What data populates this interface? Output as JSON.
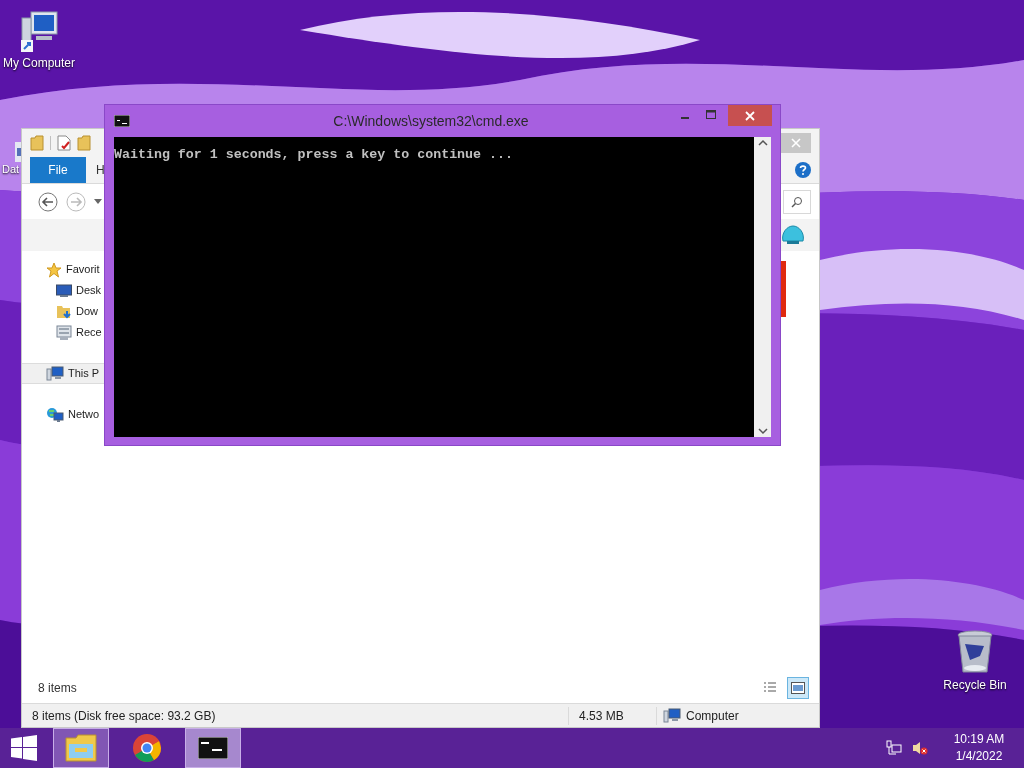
{
  "desktop": {
    "icons": [
      {
        "kind": "computer",
        "label": "My Computer"
      },
      {
        "kind": "file",
        "label": "Dat"
      },
      {
        "kind": "bin",
        "label": "Recycle Bin"
      }
    ]
  },
  "explorer": {
    "ribbon_tabs": [
      {
        "label": "File",
        "selected": true
      },
      {
        "label": "H",
        "selected": false
      }
    ],
    "navigation": [
      {
        "kind": "star",
        "label": "Favorit",
        "selected": false,
        "children": [
          {
            "kind": "desktop",
            "label": "Desk",
            "selected": false
          },
          {
            "kind": "downloads",
            "label": "Dow",
            "selected": false
          },
          {
            "kind": "recent",
            "label": "Rece",
            "selected": false
          }
        ]
      },
      {
        "kind": "pc",
        "label": "This P",
        "selected": true
      },
      {
        "kind": "network",
        "label": "Netwo",
        "selected": false
      }
    ],
    "item_count": "8 items",
    "view_buttons": [
      {
        "kind": "details",
        "selected": false
      },
      {
        "kind": "tiles",
        "selected": true
      }
    ],
    "status_bar": [
      "8 items (Disk free space: 93.2 GB)",
      "4.53 MB",
      "Computer"
    ]
  },
  "console": {
    "title": "C:\\Windows\\system32\\cmd.exe",
    "lines": [
      "Waiting for 1 seconds, press a key to continue ..."
    ]
  },
  "taskbar": {
    "apps": [
      {
        "kind": "explorer",
        "running": true,
        "selected": false
      },
      {
        "kind": "chrome",
        "running": false,
        "selected": false
      },
      {
        "kind": "console",
        "running": true,
        "selected": true
      }
    ],
    "clock": {
      "time": "10:19 AM",
      "date": "1/4/2022"
    }
  }
}
